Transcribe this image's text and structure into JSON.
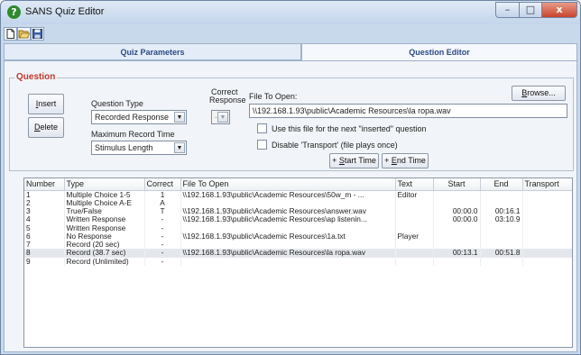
{
  "window": {
    "title": "SANS Quiz Editor",
    "app_icon": "question-mark-icon",
    "minimize": "–",
    "maximize": "□",
    "close": "x"
  },
  "toolbar": {
    "icons": [
      "new-document-icon",
      "open-folder-icon",
      "save-disk-icon"
    ]
  },
  "tabs": {
    "quiz_parameters": "Quiz Parameters",
    "question_editor": "Question Editor",
    "active": "Question Editor"
  },
  "question": {
    "legend": "Question",
    "insert_label": "nsert",
    "insert_mnemonic": "I",
    "delete_label": "elete",
    "delete_mnemonic": "D",
    "question_type_label": "Question Type",
    "question_type_value": "Recorded Response",
    "correct_response_label_1": "Correct",
    "correct_response_label_2": "Response",
    "correct_response_value": "-",
    "max_record_label": "Maximum Record Time",
    "max_record_value": "Stimulus Length",
    "file_to_open_label": "File To Open:",
    "file_value": "\\\\192.168.1.93\\public\\Academic Resources\\la ropa.wav",
    "browse_mnemonic": "B",
    "browse_label": "rowse...",
    "use_file_label": "Use this file for the next \"inserted\" question",
    "use_file_checked": false,
    "disable_transport_label": "Disable 'Transport' (file plays once)",
    "disable_transport_checked": false,
    "start_prefix": "+ ",
    "start_mnemonic": "S",
    "start_label": "tart Time",
    "end_prefix": "+ ",
    "end_mnemonic": "E",
    "end_label": "nd Time"
  },
  "table": {
    "columns": [
      "Number",
      "Type",
      "Correct",
      "File To Open",
      "Text",
      "Start",
      "End",
      "Transport"
    ],
    "rows": [
      {
        "number": "1",
        "type": "Multiple Choice 1-5",
        "correct": "1",
        "file": "\\\\192.168.1.93\\public\\Academic Resources\\50w_m - ...",
        "text": "Editor",
        "start": "",
        "end": "",
        "transport": ""
      },
      {
        "number": "2",
        "type": "Multiple Choice A-E",
        "correct": "A",
        "file": "",
        "text": "",
        "start": "",
        "end": "",
        "transport": ""
      },
      {
        "number": "3",
        "type": "True/False",
        "correct": "T",
        "file": "\\\\192.168.1.93\\public\\Academic Resources\\answer.wav",
        "text": "",
        "start": "00:00.0",
        "end": "00:16.1",
        "transport": ""
      },
      {
        "number": "4",
        "type": "Written Response",
        "correct": "-",
        "file": "\\\\192.168.1.93\\public\\Academic Resources\\ap listenin...",
        "text": "",
        "start": "00:00.0",
        "end": "03:10.9",
        "transport": ""
      },
      {
        "number": "5",
        "type": "Written Response",
        "correct": "-",
        "file": "",
        "text": "",
        "start": "",
        "end": "",
        "transport": ""
      },
      {
        "number": "6",
        "type": "No Response",
        "correct": "-",
        "file": "\\\\192.168.1.93\\public\\Academic Resources\\1a.txt",
        "text": "Player",
        "start": "",
        "end": "",
        "transport": ""
      },
      {
        "number": "7",
        "type": "Record (20 sec)",
        "correct": "-",
        "file": "",
        "text": "",
        "start": "",
        "end": "",
        "transport": ""
      },
      {
        "number": "8",
        "type": "Record (38.7 sec)",
        "correct": "-",
        "file": "\\\\192.168.1.93\\public\\Academic Resources\\la ropa.wav",
        "text": "",
        "start": "00:13.1",
        "end": "00:51.8",
        "transport": ""
      },
      {
        "number": "9",
        "type": "Record (Unlimited)",
        "correct": "-",
        "file": "",
        "text": "",
        "start": "",
        "end": "",
        "transport": ""
      }
    ],
    "selected_row": "8"
  }
}
